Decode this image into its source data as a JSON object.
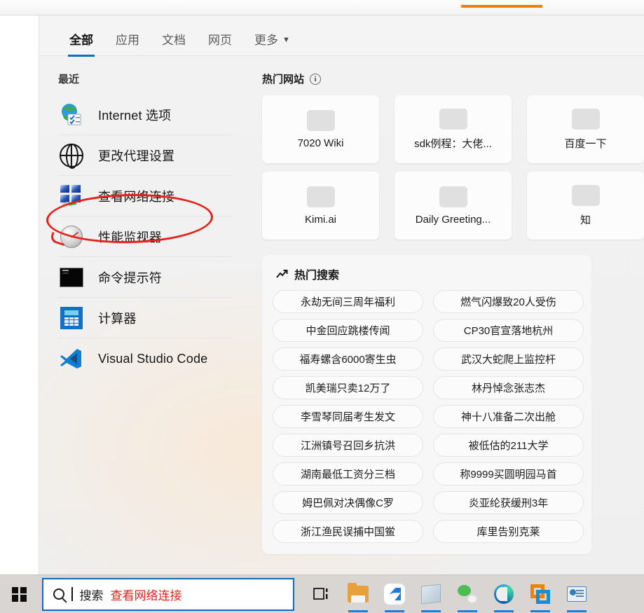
{
  "window": {
    "behind_tab_accent": "#ef7d00"
  },
  "tabs": [
    {
      "label": "全部",
      "active": true
    },
    {
      "label": "应用",
      "active": false
    },
    {
      "label": "文档",
      "active": false
    },
    {
      "label": "网页",
      "active": false
    },
    {
      "label": "更多",
      "active": false,
      "caret": "▼"
    }
  ],
  "left": {
    "section_label": "最近",
    "items": [
      {
        "label": "Internet 选项",
        "icon": "internet-options-icon"
      },
      {
        "label": "更改代理设置",
        "icon": "globe-icon"
      },
      {
        "label": "查看网络连接",
        "icon": "network-connections-icon",
        "annotated": true
      },
      {
        "label": "性能监视器",
        "icon": "performance-monitor-icon"
      },
      {
        "label": "命令提示符",
        "icon": "command-prompt-icon"
      },
      {
        "label": "计算器",
        "icon": "calculator-icon"
      },
      {
        "label": "Visual Studio Code",
        "icon": "vscode-icon"
      }
    ]
  },
  "right": {
    "sites_header": "热门网站",
    "info_glyph": "i",
    "tiles": [
      {
        "label": "7020 Wiki"
      },
      {
        "label": "sdk例程：大佬..."
      },
      {
        "label": "百度一下"
      },
      {
        "label": "Kimi.ai"
      },
      {
        "label": "Daily Greeting..."
      },
      {
        "label": "知"
      }
    ],
    "trending_header": "热门搜索",
    "trending_icon": "trending-up-icon",
    "trending": [
      "永劫无间三周年福利",
      "燃气闪爆致20人受伤",
      "中金回应跳楼传闻",
      "CP30官宣落地杭州",
      "福寿螺含6000寄生虫",
      "武汉大蛇爬上监控杆",
      "凯美瑞只卖12万了",
      "林丹悼念张志杰",
      "李雪琴同届考生发文",
      "神十八准备二次出舱",
      "江洲镇号召回乡抗洪",
      "被低估的211大学",
      "湖南最低工资分三档",
      "称9999买圆明园马首",
      "姆巴佩对决偶像C罗",
      "炎亚纶获缓刑3年",
      "浙江渔民误捕中国鲎",
      "库里告别克莱"
    ]
  },
  "taskbar": {
    "start_icon": "windows-logo-icon",
    "search": {
      "icon": "search-icon",
      "placeholder": "搜索",
      "value": "查看网络连接",
      "value_color": "#e8201a",
      "border_color": "#0f6cbd"
    },
    "icons": [
      {
        "name": "task-view-icon"
      },
      {
        "name": "file-explorer-icon"
      },
      {
        "name": "blue-app-icon"
      },
      {
        "name": "notepad-icon"
      },
      {
        "name": "wechat-icon"
      },
      {
        "name": "edge-icon"
      },
      {
        "name": "vmware-icon"
      },
      {
        "name": "media-app-icon"
      }
    ]
  },
  "annotation": {
    "color": "#e8201a",
    "shape": "hand-drawn-ellipse",
    "target": "查看网络连接"
  }
}
